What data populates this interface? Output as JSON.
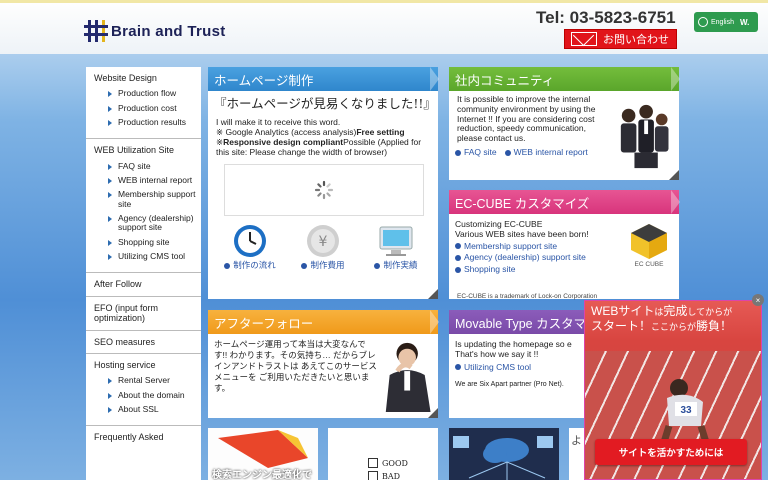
{
  "header": {
    "logo_text": "Brain and Trust",
    "tel": "Tel: 03-5823-6751",
    "contact_label": "お問い合わせ",
    "language_label": "English",
    "language_suffix": "W."
  },
  "sidebar": {
    "sections": [
      {
        "heading": "Website Design",
        "items": [
          "Production flow",
          "Production cost",
          "Production results"
        ]
      },
      {
        "heading": "WEB Utilization Site",
        "items": [
          "FAQ site",
          "WEB internal report",
          "Membership support site",
          "Agency (dealership) support site",
          "Shopping site",
          "Utilizing CMS tool"
        ]
      },
      {
        "heading": "After Follow",
        "items": []
      },
      {
        "heading": "EFO (input form optimization)",
        "items": []
      },
      {
        "heading": "SEO measures",
        "items": []
      },
      {
        "heading": "Hosting service",
        "items": [
          "Rental Server",
          "About the domain",
          "About SSL"
        ]
      },
      {
        "heading": "Frequently Asked",
        "items": []
      }
    ]
  },
  "homepage_panel": {
    "title": "ホームページ制作",
    "headline": "『ホームページが見易くなりました!!』",
    "line1": "I will make it to receive this word.",
    "line2_a": "※ Google Analytics (access analysis)",
    "line2_b": "Free setting",
    "line3_a": "※",
    "line3_b": "Responsive design compliant",
    "line3_c": "Possible (Applied for this site: Please change the width of browser)",
    "links": [
      "制作の流れ",
      "制作費用",
      "制作実績"
    ]
  },
  "community_panel": {
    "title": "社内コミュニティ",
    "text": "It is possible to improve the internal community environment by using the Internet !! If you are considering cost reduction, speedy communication, please contact us.",
    "links": [
      "FAQ site",
      "WEB internal report"
    ]
  },
  "eccube_panel": {
    "title": "EC-CUBE カスタマイズ",
    "text1": "Customizing EC-CUBE",
    "text2": "Various WEB sites have been born!",
    "links": [
      "Membership support site",
      "Agency (dealership) support site",
      "Shopping site"
    ],
    "logo_label": "EC CUBE",
    "footnote": "EC-CUBE is a trademark of Lock-on Corporation"
  },
  "after_panel": {
    "title": "アフターフォロー",
    "text": "ホームページ運用って本当は大変なんです!! わかります。その気持ち… だからブレインアンドトラストは あえてこのサービスメニューを ご利用いただきたいと思います。"
  },
  "movable_panel": {
    "title": "Movable Type カスタマイズ",
    "text1": "Is updating the homepage so e",
    "text2": "That's how we say it !!",
    "link": "Utilizing CMS tool",
    "partner": "We are Six Apart partner (Pro Net)."
  },
  "bottom_row": {
    "seo_caption": "検索エンジン最適化で",
    "good_label": "GOOD",
    "bad_label": "BAD",
    "partial_char": "よ"
  },
  "popup": {
    "line1_a": "WEBサイト",
    "line1_b": "は",
    "line1_c": "完成",
    "line1_d": "してからが",
    "line2_a": "スタート！",
    "line2_b": "ここからが",
    "line2_c": "勝負！",
    "bib_number": "33",
    "cta": "サイトを活かすためには",
    "close": "×"
  },
  "colors": {
    "blue_title": "#2f86cc",
    "green_title": "#5aa62b",
    "orange_title": "#f09a1a",
    "purple_title": "#7a4aa8",
    "pink_title": "#d8347c",
    "red_button": "#e1141a"
  }
}
